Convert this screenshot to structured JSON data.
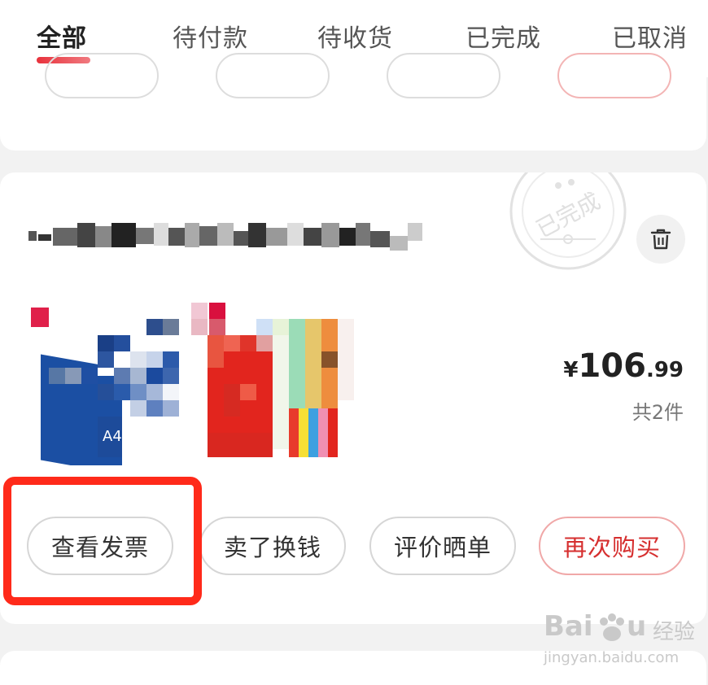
{
  "tabs": [
    {
      "label": "全部",
      "active": true
    },
    {
      "label": "待付款",
      "active": false
    },
    {
      "label": "待收货",
      "active": false
    },
    {
      "label": "已完成",
      "active": false
    },
    {
      "label": "已取消",
      "active": false
    }
  ],
  "order": {
    "stamp_text": "已完成",
    "price": {
      "currency": "¥",
      "integer": "106",
      "decimal": ".99"
    },
    "count": "共2件",
    "products": [
      "product-image-1",
      "product-image-2"
    ],
    "actions": {
      "view_invoice": "查看发票",
      "sell_for_cash": "卖了换钱",
      "review": "评价晒单",
      "buy_again": "再次购买"
    }
  },
  "watermark": {
    "brand": "Bai",
    "brand_suffix": "经验",
    "url": "jingyan.baidu.com"
  },
  "colors": {
    "accent": "#e8323c",
    "highlight_box": "#ff2a1a"
  }
}
